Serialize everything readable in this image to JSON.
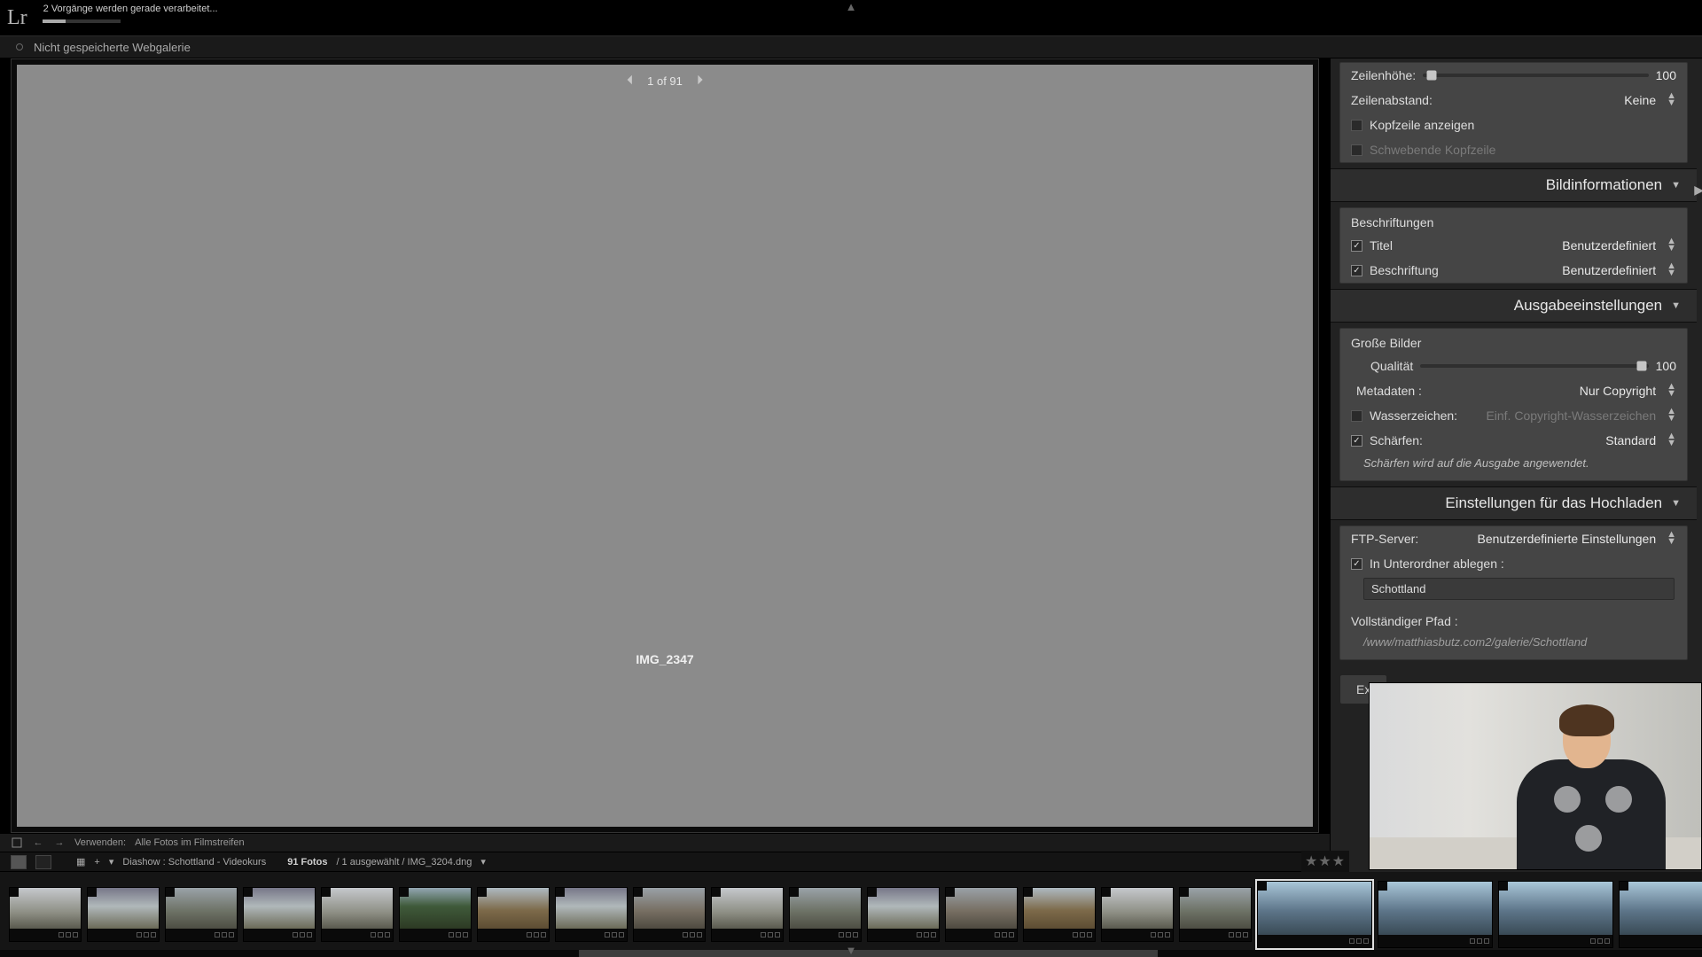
{
  "titlebar": {
    "logo": "Lr",
    "processing": "2 Vorgänge werden gerade verarbeitet..."
  },
  "subheader": {
    "label": "Nicht gespeicherte Webgalerie"
  },
  "preview": {
    "pager": "1 of 91",
    "image_title": "IMG_2347"
  },
  "side": {
    "row_group1": {
      "row_height_label": "Zeilenhöhe:",
      "row_height_val": "100",
      "row_spacing_label": "Zeilenabstand:",
      "row_spacing_val": "Keine",
      "header_show": "Kopfzeile anzeigen",
      "header_float": "Schwebende Kopfzeile"
    },
    "sec_imageinfo": "Bildinformationen",
    "captions": {
      "title": "Beschriftungen",
      "title_label": "Titel",
      "title_val": "Benutzerdefiniert",
      "caption_label": "Beschriftung",
      "caption_val": "Benutzerdefiniert"
    },
    "sec_output": "Ausgabeeinstellungen",
    "output": {
      "large": "Große Bilder",
      "quality_label": "Qualität",
      "quality_val": "100",
      "metadata_label": "Metadaten :",
      "metadata_val": "Nur Copyright",
      "watermark_label": "Wasserzeichen:",
      "watermark_val": "Einf. Copyright-Wasserzeichen",
      "sharpen_label": "Schärfen:",
      "sharpen_val": "Standard",
      "sharpen_note": "Schärfen wird auf die Ausgabe angewendet."
    },
    "sec_upload": "Einstellungen für das Hochladen",
    "upload": {
      "ftp_label": "FTP-Server:",
      "ftp_val": "Benutzerdefinierte Einstellungen",
      "subfolder_label": "In Unterordner ablegen :",
      "subfolder_val": "Schottland",
      "fullpath_label": "Vollständiger Pfad :",
      "fullpath_val": "/www/matthiasbutz.com2/galerie/Schottland"
    },
    "export_btn": "Ex"
  },
  "toolstrip": {
    "use": "Verwenden:",
    "scope": "Alle Fotos im Filmstreifen"
  },
  "sourcebar": {
    "source": "Diashow : Schottland - Videokurs",
    "count": "91 Fotos",
    "sel": "/ 1 ausgewählt / IMG_3204.dng"
  },
  "thumbs": 20
}
